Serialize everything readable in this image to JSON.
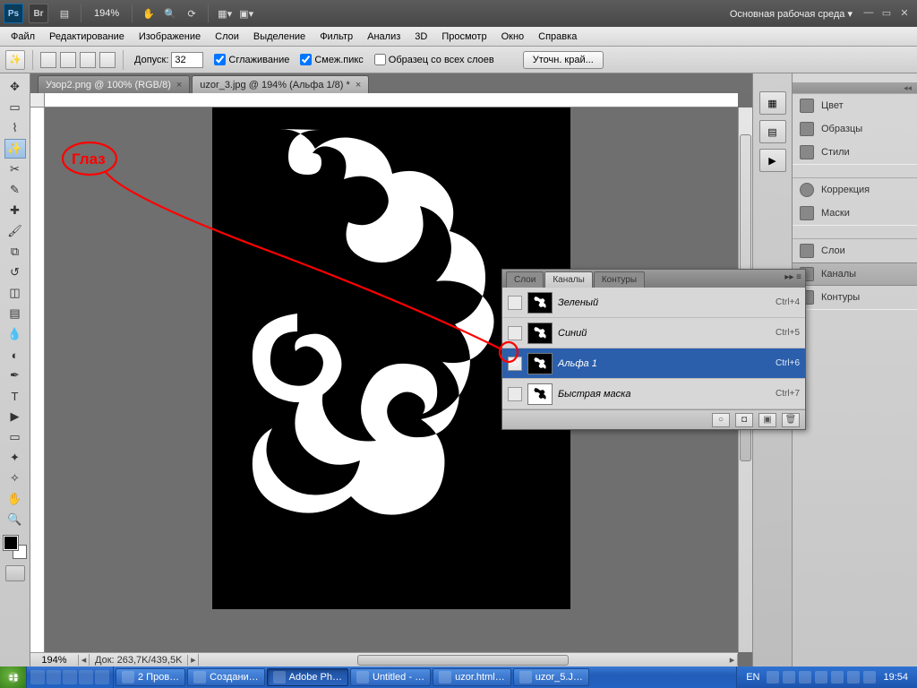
{
  "appbar": {
    "zoom": "194%",
    "workspace": "Основная рабочая среда ▾"
  },
  "menu": [
    "Файл",
    "Редактирование",
    "Изображение",
    "Слои",
    "Выделение",
    "Фильтр",
    "Анализ",
    "3D",
    "Просмотр",
    "Окно",
    "Справка"
  ],
  "options": {
    "tolerance_label": "Допуск:",
    "tolerance_value": "32",
    "antialias": "Сглаживание",
    "contiguous": "Смеж.пикс",
    "all_layers": "Образец со всех слоев",
    "refine": "Уточн. край..."
  },
  "doctabs": [
    {
      "label": "Узор2.png @ 100% (RGB/8)",
      "active": false
    },
    {
      "label": "uzor_3.jpg @ 194% (Альфа 1/8) *",
      "active": true
    }
  ],
  "statusbar": {
    "zoom": "194%",
    "doc_info": "Док: 263,7K/439,5K"
  },
  "channels_panel": {
    "tabs": [
      "Слои",
      "Каналы",
      "Контуры"
    ],
    "active_tab": "Каналы",
    "rows": [
      {
        "name": "Зеленый",
        "shortcut": "Ctrl+4",
        "eye": false,
        "selected": false
      },
      {
        "name": "Синий",
        "shortcut": "Ctrl+5",
        "eye": false,
        "selected": false
      },
      {
        "name": "Альфа 1",
        "shortcut": "Ctrl+6",
        "eye": true,
        "selected": true
      },
      {
        "name": "Быстрая маска",
        "shortcut": "Ctrl+7",
        "eye": false,
        "selected": false
      }
    ]
  },
  "right_panel": {
    "group1": [
      "Цвет",
      "Образцы",
      "Стили"
    ],
    "group2": [
      "Коррекция",
      "Маски"
    ],
    "group3": [
      "Слои",
      "Каналы",
      "Контуры"
    ],
    "active": "Каналы"
  },
  "annotation": {
    "label": "Глаз"
  },
  "taskbar": {
    "tasks": [
      {
        "label": "2 Пров…",
        "active": false
      },
      {
        "label": "Создани…",
        "active": false
      },
      {
        "label": "Adobe Ph…",
        "active": true
      },
      {
        "label": "Untitled - …",
        "active": false
      },
      {
        "label": "uzor.html…",
        "active": false
      },
      {
        "label": "uzor_5.J…",
        "active": false
      }
    ],
    "lang": "EN",
    "clock": "19:54"
  }
}
